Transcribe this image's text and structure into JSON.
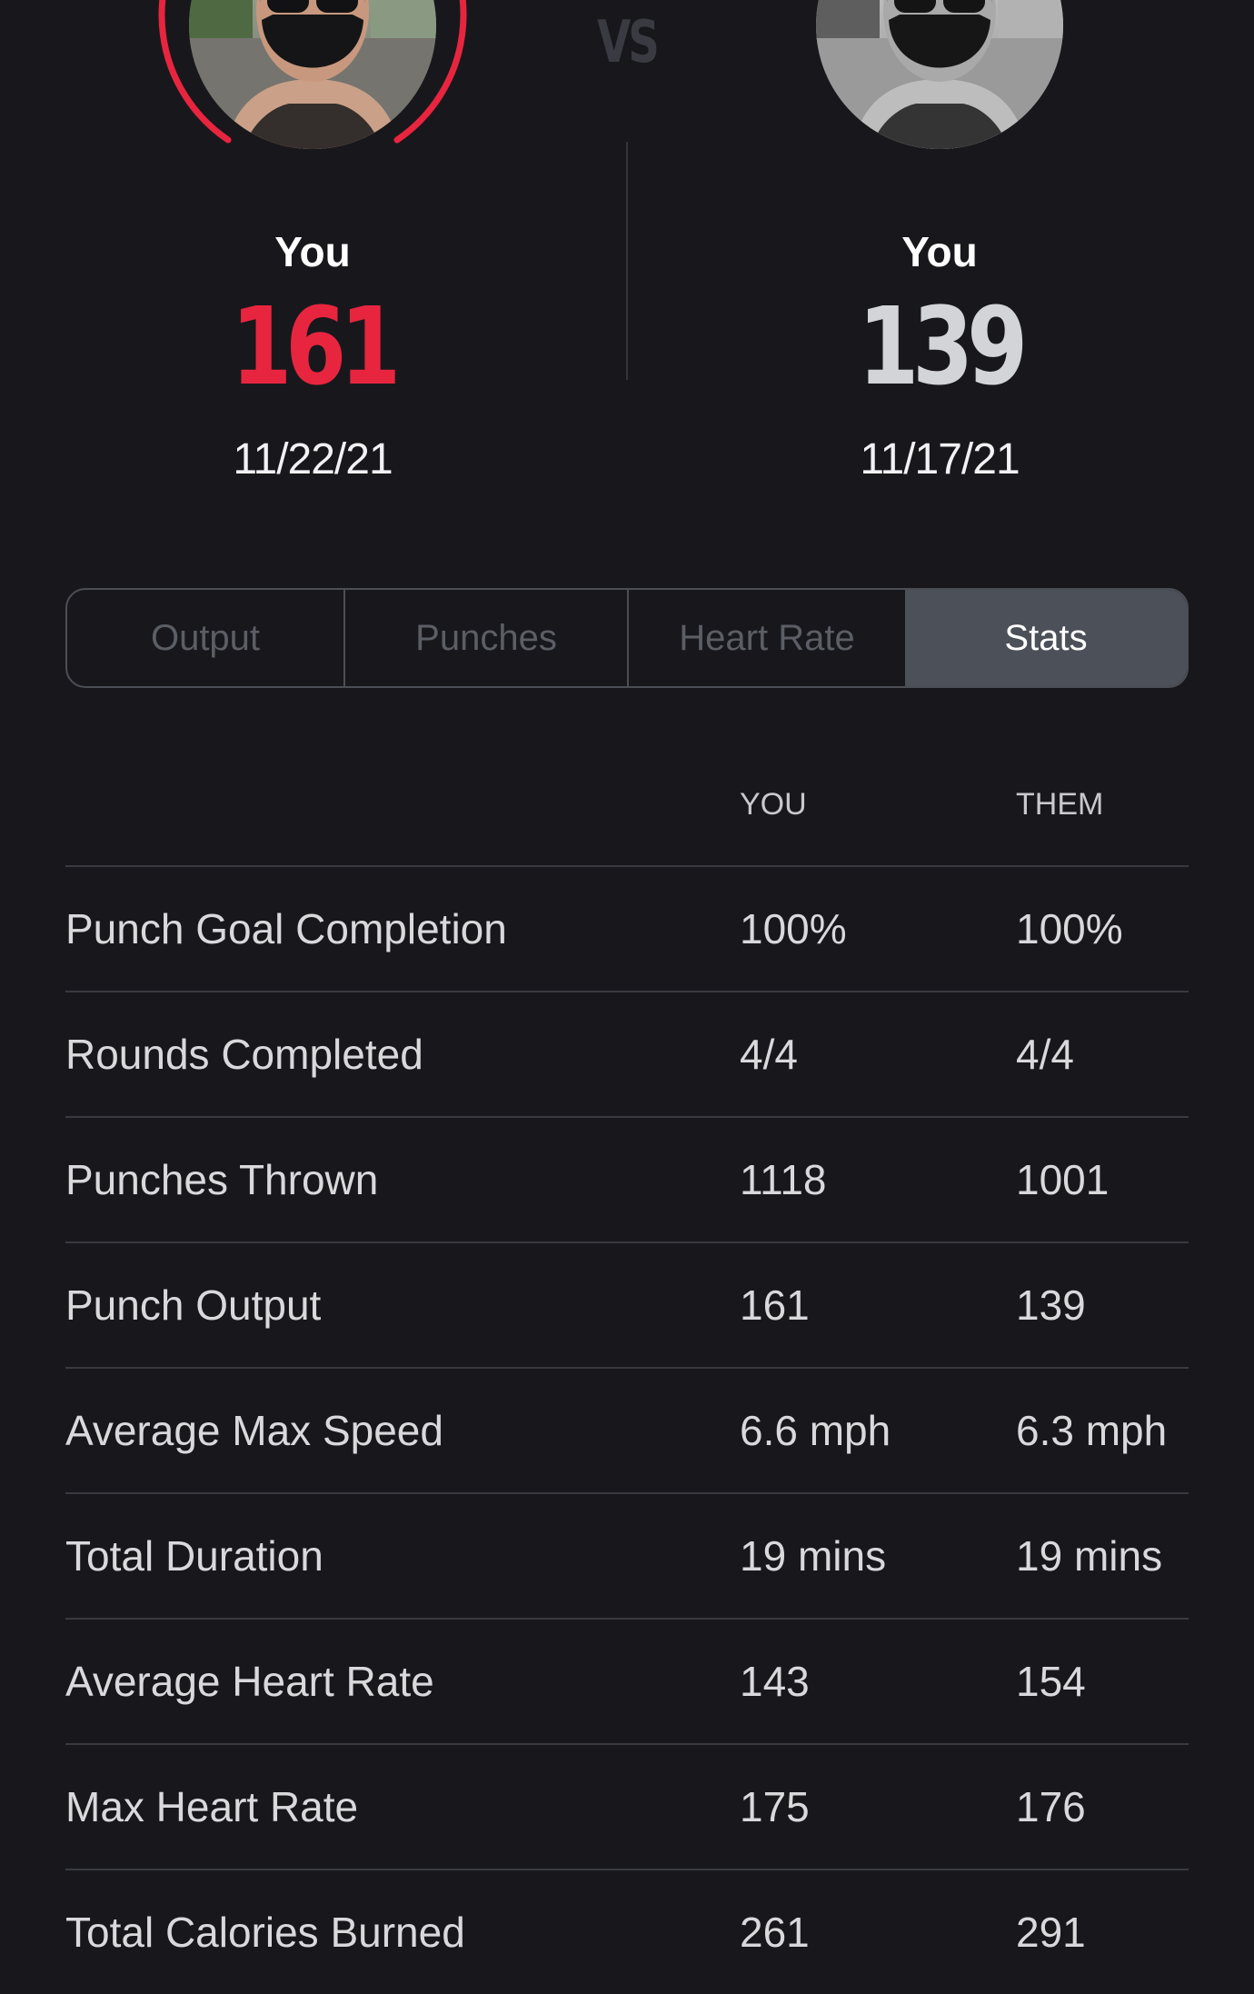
{
  "comparison": {
    "vs_label": "VS",
    "left": {
      "name": "You",
      "score": "161",
      "date": "11/22/21",
      "ring_color": "#e8253f"
    },
    "right": {
      "name": "You",
      "score": "139",
      "date": "11/17/21"
    }
  },
  "tabs": [
    {
      "label": "Output",
      "active": false
    },
    {
      "label": "Punches",
      "active": false
    },
    {
      "label": "Heart Rate",
      "active": false
    },
    {
      "label": "Stats",
      "active": true
    }
  ],
  "stats": {
    "columns": {
      "you": "YOU",
      "them": "THEM"
    },
    "rows": [
      {
        "label": "Punch Goal Completion",
        "you": "100%",
        "them": "100%"
      },
      {
        "label": "Rounds Completed",
        "you": "4/4",
        "them": "4/4"
      },
      {
        "label": "Punches Thrown",
        "you": "1118",
        "them": "1001"
      },
      {
        "label": "Punch Output",
        "you": "161",
        "them": "139"
      },
      {
        "label": "Average Max Speed",
        "you": "6.6 mph",
        "them": "6.3 mph"
      },
      {
        "label": "Total Duration",
        "you": "19 mins",
        "them": "19 mins"
      },
      {
        "label": "Average Heart Rate",
        "you": "143",
        "them": "154"
      },
      {
        "label": "Max Heart Rate",
        "you": "175",
        "them": "176"
      },
      {
        "label": "Total Calories Burned",
        "you": "261",
        "them": "291"
      }
    ]
  },
  "colors": {
    "background": "#18181c",
    "accent_red": "#e8253f",
    "tab_active_bg": "#4c5058"
  }
}
